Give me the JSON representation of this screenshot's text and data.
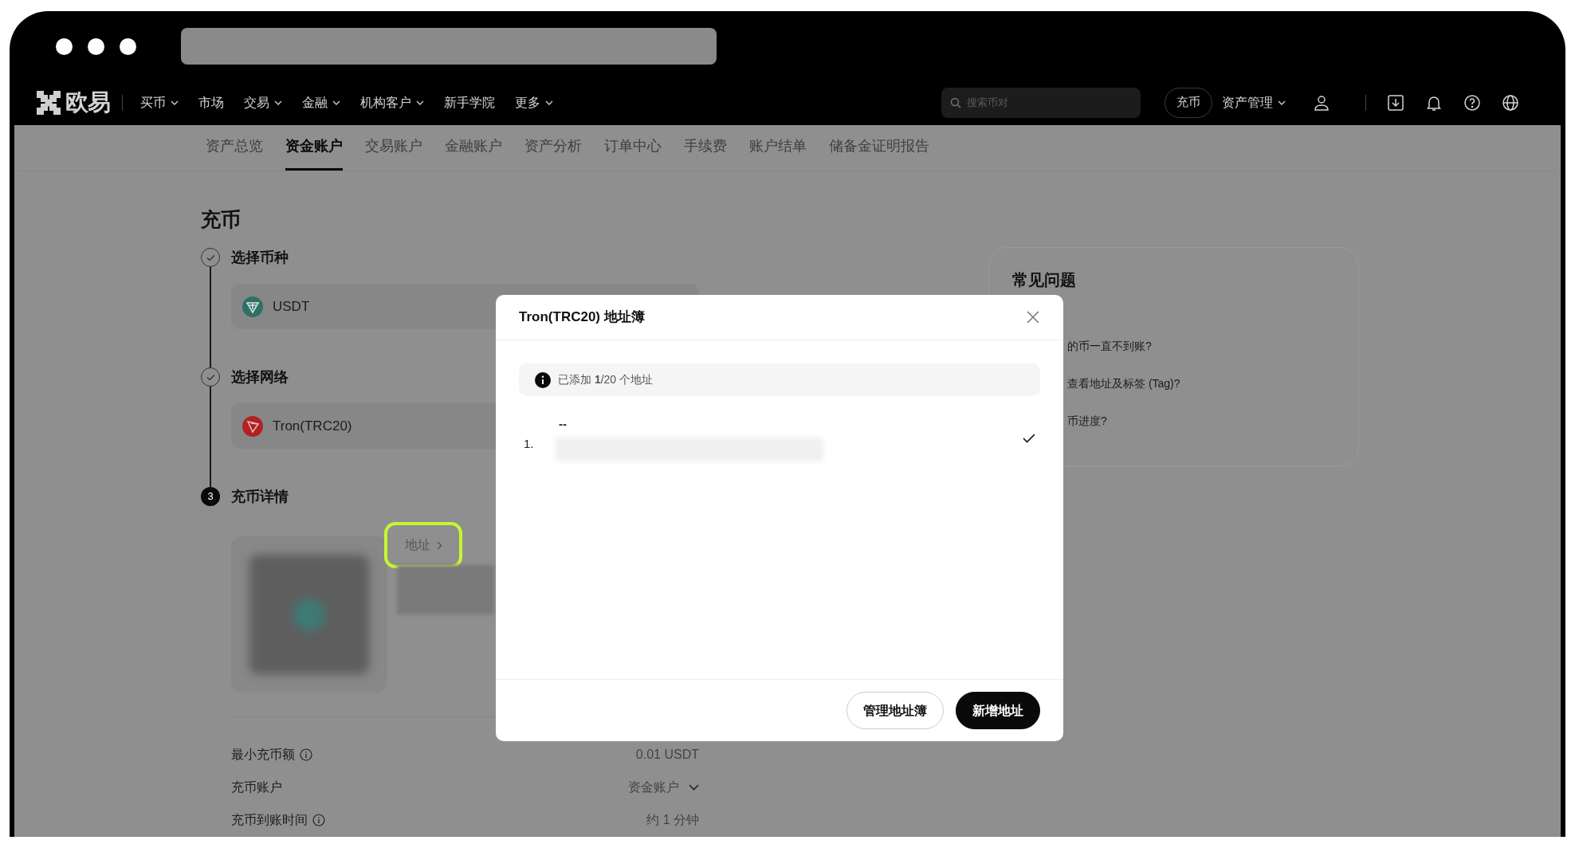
{
  "nav": {
    "logo": "欧易",
    "items": [
      {
        "label": "买币",
        "dropdown": true
      },
      {
        "label": "市场",
        "dropdown": false
      },
      {
        "label": "交易",
        "dropdown": true
      },
      {
        "label": "金融",
        "dropdown": true
      },
      {
        "label": "机构客户",
        "dropdown": true
      },
      {
        "label": "新手学院",
        "dropdown": false
      },
      {
        "label": "更多",
        "dropdown": true
      }
    ],
    "search": {
      "placeholder": "搜索币对"
    },
    "deposit_button": "充币",
    "asset_menu": {
      "label": "资产管理",
      "dropdown": true
    }
  },
  "subtabs": [
    {
      "label": "资产总览",
      "selected": false
    },
    {
      "label": "资金账户",
      "selected": true
    },
    {
      "label": "交易账户",
      "selected": false
    },
    {
      "label": "金融账户",
      "selected": false
    },
    {
      "label": "资产分析",
      "selected": false
    },
    {
      "label": "订单中心",
      "selected": false
    },
    {
      "label": "手续费",
      "selected": false
    },
    {
      "label": "账户结单",
      "selected": false
    },
    {
      "label": "储备金证明报告",
      "selected": false
    }
  ],
  "deposit": {
    "title": "充币",
    "steps": [
      {
        "label": "选择币种",
        "done": true,
        "kind": "select",
        "value": "USDT"
      },
      {
        "label": "选择网络",
        "done": true,
        "kind": "select",
        "value": "Tron(TRC20)"
      },
      {
        "label": "充币详情",
        "done": false,
        "number": "3",
        "kind": "details"
      }
    ],
    "address_tab": {
      "label": "地址",
      "highlighted": true
    },
    "details": [
      {
        "label": "最小充币额",
        "info": true,
        "value": "0.01 USDT",
        "dropdown": false
      },
      {
        "label": "充币账户",
        "info": false,
        "value": "资金账户",
        "dropdown": true
      },
      {
        "label": "充币到账时间",
        "info": true,
        "value": "约 1 分钟",
        "dropdown": false
      }
    ]
  },
  "faq": {
    "title": "常见问题",
    "items": [
      "的币一直不到账?",
      "查看地址及标签 (Tag)?",
      "币进度?"
    ]
  },
  "modal": {
    "title": "Tron(TRC20) 地址簿",
    "notice": "已添加 **1**/20 个地址",
    "addresses": [
      {
        "index": "1.",
        "name": "--",
        "selected": true
      }
    ],
    "buttons": [
      {
        "label": "管理地址簿",
        "kind": "secondary"
      },
      {
        "label": "新增地址",
        "kind": "primary"
      }
    ]
  }
}
